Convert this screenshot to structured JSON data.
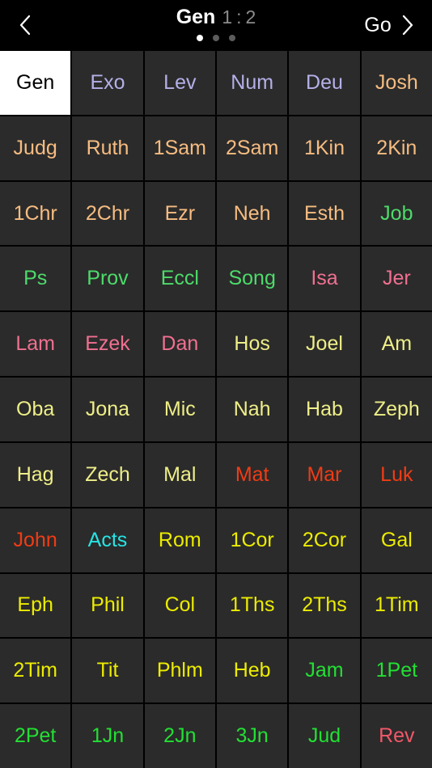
{
  "header": {
    "back_icon": "chevron-left-icon",
    "forward_icon": "chevron-right-icon",
    "go_label": "Go",
    "title_book": "Gen",
    "title_chapter": "1",
    "title_separator": ":",
    "title_verse": "2",
    "pager": {
      "total": 3,
      "active_index": 0
    }
  },
  "colors": {
    "background": "#000000",
    "cell_background": "#2b2b2b",
    "selected_background": "#ffffff",
    "selected_text": "#000000",
    "lavender": "#b4b0e8",
    "peach": "#f6bc81",
    "green": "#4ddb6a",
    "pink": "#f07090",
    "pale_yellow": "#eeee88",
    "orange_red": "#f03c14",
    "cyan": "#26e5e5",
    "bright_yellow": "#ecec00",
    "bright_green": "#22e033",
    "salmon": "#f05868",
    "title_ref": "#8c8c8c",
    "dot_active": "#ffffff",
    "dot_inactive": "#5c5c5c"
  },
  "grid": {
    "columns": 6,
    "rows": 11,
    "books": [
      {
        "label": "Gen",
        "color": "#000000",
        "selected": true
      },
      {
        "label": "Exo",
        "color": "#b4b0e8",
        "selected": false
      },
      {
        "label": "Lev",
        "color": "#b4b0e8",
        "selected": false
      },
      {
        "label": "Num",
        "color": "#b4b0e8",
        "selected": false
      },
      {
        "label": "Deu",
        "color": "#b4b0e8",
        "selected": false
      },
      {
        "label": "Josh",
        "color": "#f6bc81",
        "selected": false
      },
      {
        "label": "Judg",
        "color": "#f6bc81",
        "selected": false
      },
      {
        "label": "Ruth",
        "color": "#f6bc81",
        "selected": false
      },
      {
        "label": "1Sam",
        "color": "#f6bc81",
        "selected": false
      },
      {
        "label": "2Sam",
        "color": "#f6bc81",
        "selected": false
      },
      {
        "label": "1Kin",
        "color": "#f6bc81",
        "selected": false
      },
      {
        "label": "2Kin",
        "color": "#f6bc81",
        "selected": false
      },
      {
        "label": "1Chr",
        "color": "#f6bc81",
        "selected": false
      },
      {
        "label": "2Chr",
        "color": "#f6bc81",
        "selected": false
      },
      {
        "label": "Ezr",
        "color": "#f6bc81",
        "selected": false
      },
      {
        "label": "Neh",
        "color": "#f6bc81",
        "selected": false
      },
      {
        "label": "Esth",
        "color": "#f6bc81",
        "selected": false
      },
      {
        "label": "Job",
        "color": "#4ddb6a",
        "selected": false
      },
      {
        "label": "Ps",
        "color": "#4ddb6a",
        "selected": false
      },
      {
        "label": "Prov",
        "color": "#4ddb6a",
        "selected": false
      },
      {
        "label": "Eccl",
        "color": "#4ddb6a",
        "selected": false
      },
      {
        "label": "Song",
        "color": "#4ddb6a",
        "selected": false
      },
      {
        "label": "Isa",
        "color": "#f07090",
        "selected": false
      },
      {
        "label": "Jer",
        "color": "#f07090",
        "selected": false
      },
      {
        "label": "Lam",
        "color": "#f07090",
        "selected": false
      },
      {
        "label": "Ezek",
        "color": "#f07090",
        "selected": false
      },
      {
        "label": "Dan",
        "color": "#f07090",
        "selected": false
      },
      {
        "label": "Hos",
        "color": "#eeee88",
        "selected": false
      },
      {
        "label": "Joel",
        "color": "#eeee88",
        "selected": false
      },
      {
        "label": "Am",
        "color": "#eeee88",
        "selected": false
      },
      {
        "label": "Oba",
        "color": "#eeee88",
        "selected": false
      },
      {
        "label": "Jona",
        "color": "#eeee88",
        "selected": false
      },
      {
        "label": "Mic",
        "color": "#eeee88",
        "selected": false
      },
      {
        "label": "Nah",
        "color": "#eeee88",
        "selected": false
      },
      {
        "label": "Hab",
        "color": "#eeee88",
        "selected": false
      },
      {
        "label": "Zeph",
        "color": "#eeee88",
        "selected": false
      },
      {
        "label": "Hag",
        "color": "#eeee88",
        "selected": false
      },
      {
        "label": "Zech",
        "color": "#eeee88",
        "selected": false
      },
      {
        "label": "Mal",
        "color": "#eeee88",
        "selected": false
      },
      {
        "label": "Mat",
        "color": "#f03c14",
        "selected": false
      },
      {
        "label": "Mar",
        "color": "#f03c14",
        "selected": false
      },
      {
        "label": "Luk",
        "color": "#f03c14",
        "selected": false
      },
      {
        "label": "John",
        "color": "#f03c14",
        "selected": false
      },
      {
        "label": "Acts",
        "color": "#26e5e5",
        "selected": false
      },
      {
        "label": "Rom",
        "color": "#ecec00",
        "selected": false
      },
      {
        "label": "1Cor",
        "color": "#ecec00",
        "selected": false
      },
      {
        "label": "2Cor",
        "color": "#ecec00",
        "selected": false
      },
      {
        "label": "Gal",
        "color": "#ecec00",
        "selected": false
      },
      {
        "label": "Eph",
        "color": "#ecec00",
        "selected": false
      },
      {
        "label": "Phil",
        "color": "#ecec00",
        "selected": false
      },
      {
        "label": "Col",
        "color": "#ecec00",
        "selected": false
      },
      {
        "label": "1Ths",
        "color": "#ecec00",
        "selected": false
      },
      {
        "label": "2Ths",
        "color": "#ecec00",
        "selected": false
      },
      {
        "label": "1Tim",
        "color": "#ecec00",
        "selected": false
      },
      {
        "label": "2Tim",
        "color": "#ecec00",
        "selected": false
      },
      {
        "label": "Tit",
        "color": "#ecec00",
        "selected": false
      },
      {
        "label": "Phlm",
        "color": "#ecec00",
        "selected": false
      },
      {
        "label": "Heb",
        "color": "#ecec00",
        "selected": false
      },
      {
        "label": "Jam",
        "color": "#22e033",
        "selected": false
      },
      {
        "label": "1Pet",
        "color": "#22e033",
        "selected": false
      },
      {
        "label": "2Pet",
        "color": "#22e033",
        "selected": false
      },
      {
        "label": "1Jn",
        "color": "#22e033",
        "selected": false
      },
      {
        "label": "2Jn",
        "color": "#22e033",
        "selected": false
      },
      {
        "label": "3Jn",
        "color": "#22e033",
        "selected": false
      },
      {
        "label": "Jud",
        "color": "#22e033",
        "selected": false
      },
      {
        "label": "Rev",
        "color": "#f05868",
        "selected": false
      }
    ]
  }
}
